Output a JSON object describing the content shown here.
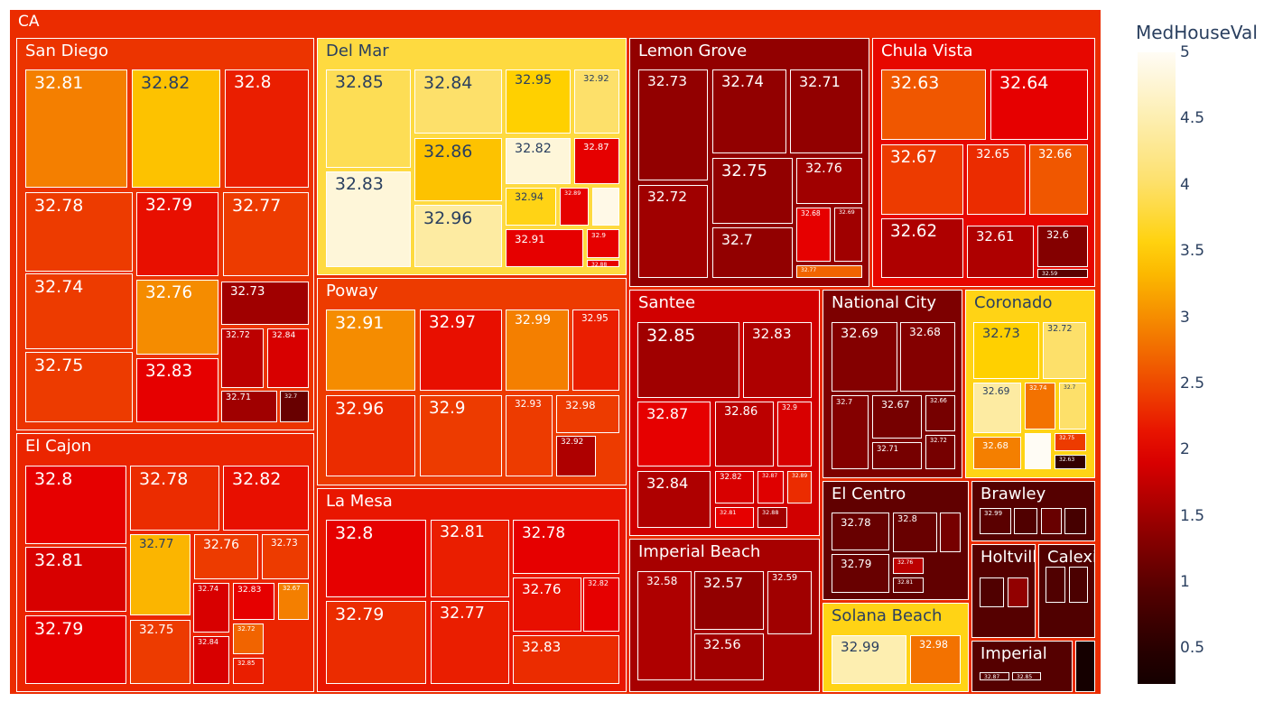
{
  "chart_data": {
    "type": "treemap",
    "root": {
      "label": "CA",
      "value": 2.3
    },
    "colorbar": {
      "title": "MedHouseVal",
      "ticks": [
        "0.5",
        "1",
        "1.5",
        "2",
        "2.5",
        "3",
        "3.5",
        "4",
        "4.5",
        "5"
      ],
      "range": [
        0.23,
        5
      ]
    },
    "colorscale": [
      [
        0.3,
        "#150000"
      ],
      [
        1.0,
        "#5a0000"
      ],
      [
        1.5,
        "#a00000"
      ],
      [
        2.0,
        "#e60000"
      ],
      [
        2.5,
        "#ef4a00"
      ],
      [
        3.0,
        "#f58c00"
      ],
      [
        3.5,
        "#ffd000"
      ],
      [
        4.0,
        "#fde06a"
      ],
      [
        4.5,
        "#fdeeb0"
      ],
      [
        5.0,
        "#fffcf5"
      ]
    ],
    "cities": [
      {
        "name": "San Diego",
        "value": 2.35,
        "children": [
          {
            "label": "32.81",
            "value": 2.9
          },
          {
            "label": "32.82",
            "value": 3.4
          },
          {
            "label": "32.8",
            "value": 2.2
          },
          {
            "label": "32.78",
            "value": 2.4
          },
          {
            "label": "32.79",
            "value": 2.1
          },
          {
            "label": "32.77",
            "value": 2.4
          },
          {
            "label": "32.74",
            "value": 2.4
          },
          {
            "label": "32.76",
            "value": 3.0
          },
          {
            "label": "32.73",
            "value": 1.5
          },
          {
            "label": "32.72",
            "value": 1.7
          },
          {
            "label": "32.84",
            "value": 1.9
          },
          {
            "label": "32.71",
            "value": 1.5
          },
          {
            "label": "32.7",
            "value": 1.1
          },
          {
            "label": "32.75",
            "value": 2.4
          },
          {
            "label": "32.83",
            "value": 2.0
          }
        ]
      },
      {
        "name": "El Cajon",
        "value": 2.25,
        "children": [
          {
            "label": "32.8",
            "value": 2.0
          },
          {
            "label": "32.78",
            "value": 2.3
          },
          {
            "label": "32.82",
            "value": 2.1
          },
          {
            "label": "32.81",
            "value": 1.9
          },
          {
            "label": "32.77",
            "value": 3.3
          },
          {
            "label": "32.76",
            "value": 2.4
          },
          {
            "label": "32.73",
            "value": 2.4
          },
          {
            "label": "32.74",
            "value": 1.9
          },
          {
            "label": "32.83",
            "value": 2.0
          },
          {
            "label": "32.67",
            "value": 2.9
          },
          {
            "label": "32.72",
            "value": 2.7
          },
          {
            "label": "32.79",
            "value": 2.0
          },
          {
            "label": "32.75",
            "value": 2.4
          },
          {
            "label": "32.84",
            "value": 1.9
          },
          {
            "label": "32.85",
            "value": 2.2
          }
        ]
      },
      {
        "name": "Del Mar",
        "value": 3.8,
        "children": [
          {
            "label": "32.85",
            "value": 3.9
          },
          {
            "label": "32.84",
            "value": 4.0
          },
          {
            "label": "32.95",
            "value": 3.5
          },
          {
            "label": "32.92",
            "value": 4.0
          },
          {
            "label": "32.86",
            "value": 3.4
          },
          {
            "label": "32.82",
            "value": 4.8
          },
          {
            "label": "32.87",
            "value": 2.0
          },
          {
            "label": "32.83",
            "value": 4.8
          },
          {
            "label": "32.96",
            "value": 4.4
          },
          {
            "label": "32.94",
            "value": 3.6
          },
          {
            "label": "32.89",
            "value": 2.0
          },
          {
            "label": "",
            "value": 4.9
          },
          {
            "label": "32.91",
            "value": 2.0
          },
          {
            "label": "32.9",
            "value": 2.0
          },
          {
            "label": "32.88",
            "value": 2.0
          }
        ]
      },
      {
        "name": "Poway",
        "value": 2.4,
        "children": [
          {
            "label": "32.91",
            "value": 3.0
          },
          {
            "label": "32.97",
            "value": 2.1
          },
          {
            "label": "32.99",
            "value": 2.9
          },
          {
            "label": "32.95",
            "value": 2.2
          },
          {
            "label": "32.96",
            "value": 2.3
          },
          {
            "label": "32.9",
            "value": 2.4
          },
          {
            "label": "32.93",
            "value": 2.4
          },
          {
            "label": "32.98",
            "value": 2.4
          },
          {
            "label": "32.92",
            "value": 1.6
          }
        ]
      },
      {
        "name": "La Mesa",
        "value": 2.15,
        "children": [
          {
            "label": "32.8",
            "value": 2.0
          },
          {
            "label": "32.81",
            "value": 2.2
          },
          {
            "label": "32.78",
            "value": 2.0
          },
          {
            "label": "32.76",
            "value": 2.1
          },
          {
            "label": "32.82",
            "value": 2.0
          },
          {
            "label": "32.79",
            "value": 2.3
          },
          {
            "label": "32.77",
            "value": 2.2
          },
          {
            "label": "32.83",
            "value": 2.3
          }
        ]
      },
      {
        "name": "Lemon Grove",
        "value": 1.4,
        "children": [
          {
            "label": "32.73",
            "value": 1.4
          },
          {
            "label": "32.74",
            "value": 1.4
          },
          {
            "label": "32.71",
            "value": 1.4
          },
          {
            "label": "32.72",
            "value": 1.5
          },
          {
            "label": "32.75",
            "value": 1.4
          },
          {
            "label": "32.76",
            "value": 1.5
          },
          {
            "label": "32.68",
            "value": 2.0
          },
          {
            "label": "32.69",
            "value": 1.5
          },
          {
            "label": "32.7",
            "value": 1.4
          },
          {
            "label": "32.77",
            "value": 2.7
          }
        ]
      },
      {
        "name": "Chula Vista",
        "value": 2.05,
        "children": [
          {
            "label": "32.63",
            "value": 2.6
          },
          {
            "label": "32.64",
            "value": 2.0
          },
          {
            "label": "32.67",
            "value": 2.4
          },
          {
            "label": "32.65",
            "value": 2.3
          },
          {
            "label": "32.66",
            "value": 2.6
          },
          {
            "label": "32.62",
            "value": 1.6
          },
          {
            "label": "32.61",
            "value": 1.6
          },
          {
            "label": "32.6",
            "value": 1.3
          },
          {
            "label": "32.59",
            "value": 1.0
          }
        ]
      },
      {
        "name": "Santee",
        "value": 1.85,
        "children": [
          {
            "label": "32.85",
            "value": 1.5
          },
          {
            "label": "32.83",
            "value": 1.6
          },
          {
            "label": "32.87",
            "value": 2.0
          },
          {
            "label": "32.86",
            "value": 1.7
          },
          {
            "label": "32.9",
            "value": 1.9
          },
          {
            "label": "32.84",
            "value": 1.6
          },
          {
            "label": "32.82",
            "value": 1.9
          },
          {
            "label": "32.87",
            "value": 1.95
          },
          {
            "label": "32.89",
            "value": 2.3
          },
          {
            "label": "32.81",
            "value": 2.0
          },
          {
            "label": "32.88",
            "value": 1.5
          }
        ]
      },
      {
        "name": "Imperial Beach",
        "value": 1.55,
        "children": [
          {
            "label": "32.58",
            "value": 1.6
          },
          {
            "label": "32.57",
            "value": 1.4
          },
          {
            "label": "32.59",
            "value": 1.5
          },
          {
            "label": "32.56",
            "value": 1.5
          }
        ]
      },
      {
        "name": "National City",
        "value": 1.25,
        "children": [
          {
            "label": "32.69",
            "value": 1.3
          },
          {
            "label": "32.68",
            "value": 1.3
          },
          {
            "label": "32.7",
            "value": 1.3
          },
          {
            "label": "32.67",
            "value": 1.2
          },
          {
            "label": "32.71",
            "value": 1.2
          },
          {
            "label": "32.66",
            "value": 1.2
          },
          {
            "label": "32.72",
            "value": 1.2
          }
        ]
      },
      {
        "name": "Coronado",
        "value": 3.6,
        "children": [
          {
            "label": "32.73",
            "value": 3.5
          },
          {
            "label": "32.72",
            "value": 4.0
          },
          {
            "label": "32.69",
            "value": 4.4
          },
          {
            "label": "32.74",
            "value": 2.8
          },
          {
            "label": "32.7",
            "value": 4.0
          },
          {
            "label": "32.68",
            "value": 2.9
          },
          {
            "label": "",
            "value": 5.0
          },
          {
            "label": "32.75",
            "value": 2.4
          },
          {
            "label": "32.63",
            "value": 0.6
          }
        ]
      },
      {
        "name": "El Centro",
        "value": 1.05,
        "children": [
          {
            "label": "32.78",
            "value": 1.1
          },
          {
            "label": "32.79",
            "value": 1.1
          },
          {
            "label": "32.8",
            "value": 1.1
          },
          {
            "label": "",
            "value": 1.2
          },
          {
            "label": "32.76",
            "value": 1.7
          },
          {
            "label": "32.81",
            "value": 1.1
          }
        ]
      },
      {
        "name": "Solana Beach",
        "value": 3.6,
        "children": [
          {
            "label": "32.99",
            "value": 4.5
          },
          {
            "label": "32.98",
            "value": 2.8
          }
        ]
      },
      {
        "name": "Brawley",
        "value": 0.95,
        "children": [
          {
            "label": "32.99",
            "value": 1.0
          },
          {
            "label": "",
            "value": 0.9
          },
          {
            "label": "",
            "value": 1.1
          },
          {
            "label": "",
            "value": 0.8
          }
        ]
      },
      {
        "name": "Holtville",
        "value": 0.95,
        "children": [
          {
            "label": "",
            "value": 0.9
          },
          {
            "label": "",
            "value": 1.4
          }
        ]
      },
      {
        "name": "Calexico",
        "value": 0.9,
        "children": [
          {
            "label": "",
            "value": 0.9
          },
          {
            "label": "",
            "value": 0.85
          }
        ]
      },
      {
        "name": "Imperial",
        "value": 0.95,
        "children": [
          {
            "label": "32.87",
            "value": 0.95
          },
          {
            "label": "32.85",
            "value": 0.95
          }
        ]
      },
      {
        "name": "",
        "value": 0.3,
        "children": []
      }
    ]
  }
}
